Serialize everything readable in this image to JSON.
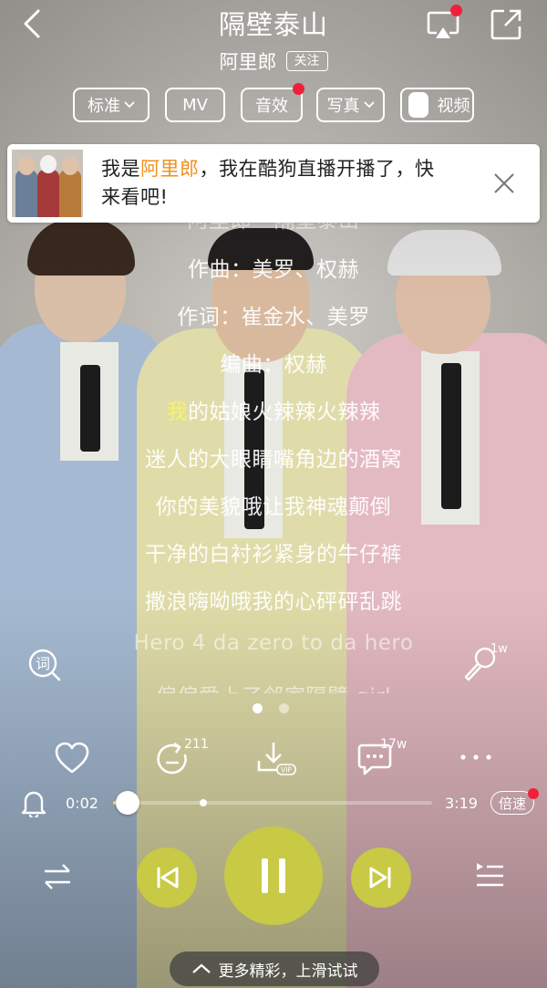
{
  "header": {
    "song_title": "隔壁泰山",
    "artist": "阿里郎",
    "follow_label": "关注"
  },
  "pills": {
    "quality": "标准",
    "mv": "MV",
    "sound_effect": "音效",
    "photo": "写真",
    "video": "视频"
  },
  "banner": {
    "prefix": "我是",
    "highlight": "阿里郎",
    "suffix_line1": "，我在酷狗直播开播了，快",
    "line2": "来看吧!"
  },
  "lyrics": {
    "lines": [
      "阿里郎 - 隔壁泰山",
      "作曲：美罗、权赫",
      "作词：崔金水、美罗",
      "编曲：权赫",
      "我的姑娘火辣辣火辣辣",
      "迷人的大眼睛嘴角边的酒窝",
      "你的美貌哦让我神魂颠倒",
      "干净的白衬衫紧身的牛仔裤",
      "撒浪嗨呦哦我的心砰砰乱跳",
      "Hero 4 da zero to da hero",
      "偏偏爱上了邻家隔壁 girl"
    ],
    "current_first_char": "我",
    "current_rest": "的姑娘火辣辣火辣辣"
  },
  "side": {
    "word_label": "词",
    "mic_count": "1w"
  },
  "actions": {
    "share_count": "211",
    "download_badge": "VIP",
    "comment_count": "17w"
  },
  "progress": {
    "current_time": "0:02",
    "total_time": "3:19",
    "fraction": 0.01,
    "speed_label": "倍速"
  },
  "colors": {
    "accent": "#c8c945",
    "lyric_highlight": "#f6f36a",
    "banner_highlight": "#f0901e",
    "notification_dot": "#f0203a"
  },
  "bottom": {
    "more_label": "更多精彩，上滑试试"
  }
}
